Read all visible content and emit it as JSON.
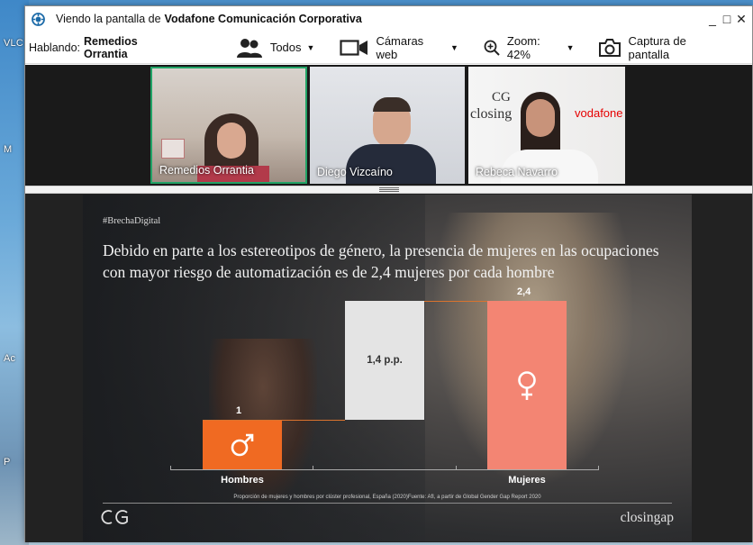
{
  "desktop": {
    "icon_labels": [
      "VLC",
      "M",
      "Ac",
      "P"
    ]
  },
  "window": {
    "title_prefix": "Viendo la pantalla de",
    "title_bold": "Vodafone Comunicación Corporativa",
    "controls": {
      "minimize": "_",
      "maximize": "□",
      "close": "✕"
    }
  },
  "toolbar": {
    "speaking_label": "Hablando:",
    "speaking_name": "Remedios Orrantia",
    "view_label": "Todos",
    "cameras_label": "Cámaras web",
    "zoom_label": "Zoom: 42%",
    "capture_label": "Captura de pantalla"
  },
  "participants": [
    {
      "name": "Remedios Orrantia",
      "active": true
    },
    {
      "name": "Diego Vizcaíno",
      "active": false
    },
    {
      "name": "Rebeca Navarro",
      "active": false
    }
  ],
  "backdrop": {
    "cg_text": "CG",
    "closing_text": "closing",
    "vodafone_text": "vodafone"
  },
  "slide": {
    "hashtag": "#BrechaDigital",
    "headline": "Debido en parte a los estereotipos de género, la presencia de mujeres en las ocupaciones con mayor riesgo de automatización es de 2,4 mujeres por cada hombre",
    "footnote": "Proporción de mujeres y hombres por clúster profesional, España (2020)Fuente: AfI, a partir de Global Gender Gap Report 2020",
    "logo_text": "CG",
    "brand": "closingap"
  },
  "chart_data": {
    "type": "bar",
    "categories": [
      "Hombres",
      "Mujeres"
    ],
    "values": [
      1,
      2.4
    ],
    "value_labels": [
      "1",
      "2,4"
    ],
    "gap_label": "1,4 p.p.",
    "colors": {
      "hombres": "#f06a22",
      "gap": "#e4e4e4",
      "mujeres": "#f38573"
    },
    "icons": {
      "hombres": "male-symbol-icon",
      "mujeres": "female-symbol-icon"
    }
  }
}
